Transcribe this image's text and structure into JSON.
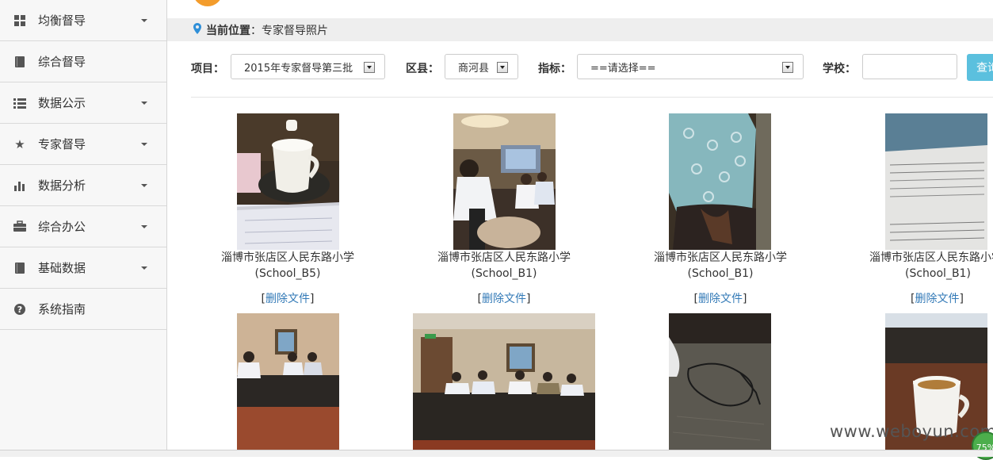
{
  "sidebar": {
    "items": [
      {
        "label": "均衡督导",
        "icon": "grid-icon",
        "has_caret": true
      },
      {
        "label": "综合督导",
        "icon": "book-icon",
        "has_caret": false
      },
      {
        "label": "数据公示",
        "icon": "list-icon",
        "has_caret": true
      },
      {
        "label": "专家督导",
        "icon": "star-icon",
        "has_caret": true
      },
      {
        "label": "数据分析",
        "icon": "bar-chart-icon",
        "has_caret": true
      },
      {
        "label": "综合办公",
        "icon": "briefcase-icon",
        "has_caret": true
      },
      {
        "label": "基础数据",
        "icon": "book-icon",
        "has_caret": true
      },
      {
        "label": "系统指南",
        "icon": "question-icon",
        "has_caret": false
      }
    ]
  },
  "breadcrumb": {
    "label": "当前位置",
    "separator": "：",
    "value": "专家督导照片"
  },
  "filters": {
    "project_label": "项目：",
    "project_value": "2015年专家督导第三批",
    "district_label": "区县：",
    "district_value": "商河县",
    "indicator_label": "指标：",
    "indicator_value": "==请选择==",
    "school_label": "学校：",
    "school_value": "",
    "search_label": "查询"
  },
  "photos": [
    {
      "name": "淄博市张店区人民东路小学",
      "code": "(School_B5)",
      "action": "删除文件"
    },
    {
      "name": "淄博市张店区人民东路小学",
      "code": "(School_B1)",
      "action": "删除文件"
    },
    {
      "name": "淄博市张店区人民东路小学",
      "code": "(School_B1)",
      "action": "删除文件"
    },
    {
      "name": "淄博市张店区人民东路小学",
      "code": "(School_B1)",
      "action": "删除文件"
    }
  ],
  "bracket_open": "[",
  "bracket_close": "]",
  "watermark": "www.weboyun.com",
  "badge": "75%",
  "colors": {
    "accent": "#5bc0de",
    "link": "#337ab7",
    "logo": "#f39c2c",
    "pin": "#2f8fd8"
  }
}
